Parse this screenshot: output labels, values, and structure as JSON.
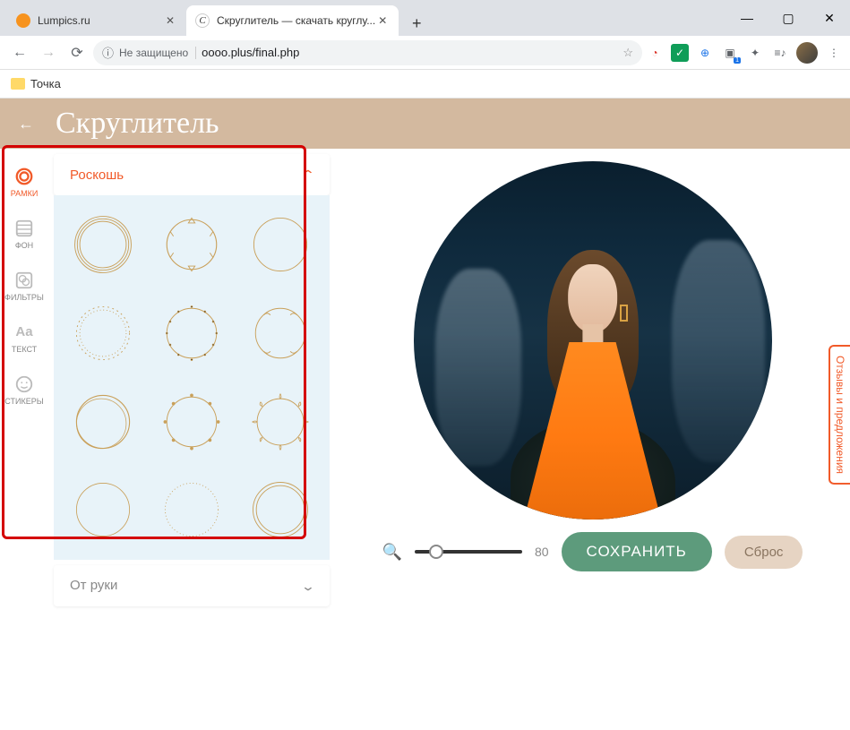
{
  "browser": {
    "tabs": [
      {
        "title": "Lumpics.ru",
        "active": false
      },
      {
        "title": "Скруглитель — скачать круглу...",
        "active": true
      }
    ],
    "security_label": "Не защищено",
    "url": "oooo.plus/final.php",
    "bookmark": "Точка"
  },
  "app": {
    "title": "Скруглитель",
    "sidebar": [
      {
        "key": "frames",
        "label": "РАМКИ",
        "active": true
      },
      {
        "key": "background",
        "label": "ФОН",
        "active": false
      },
      {
        "key": "filters",
        "label": "ФИЛЬТРЫ",
        "active": false
      },
      {
        "key": "text",
        "label": "ТЕКСТ",
        "active": false
      },
      {
        "key": "stickers",
        "label": "СТИКЕРЫ",
        "active": false
      }
    ],
    "category_open": "Роскошь",
    "category_closed": "От руки",
    "zoom_value": "80",
    "save_label": "СОХРАНИТЬ",
    "reset_label": "Сброс",
    "feedback_label": "Отзывы и предложения"
  }
}
